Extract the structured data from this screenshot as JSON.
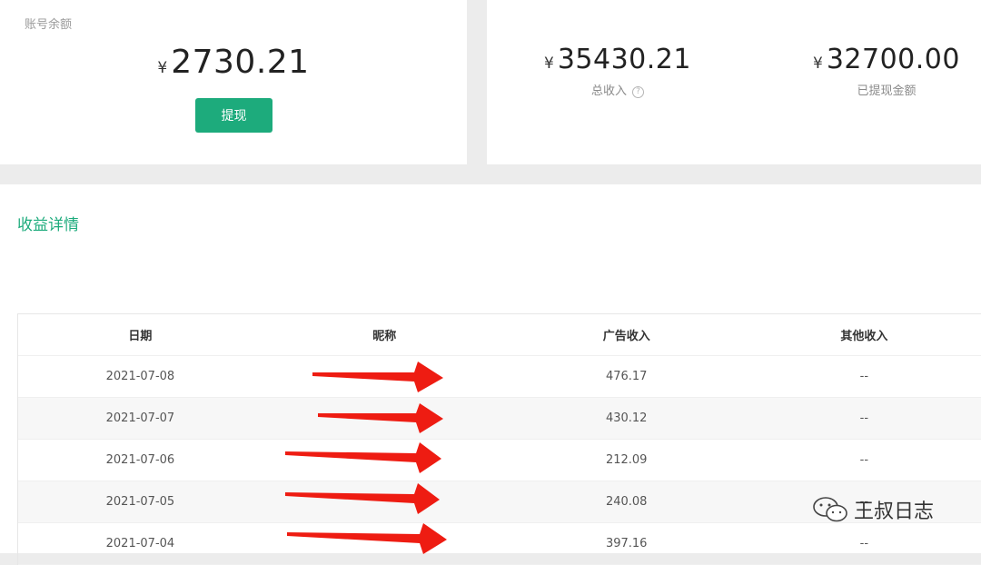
{
  "balance": {
    "label": "账号余额",
    "currency": "¥",
    "amount": "2730.21",
    "withdraw_label": "提现"
  },
  "totals": {
    "total_income": {
      "currency": "¥",
      "amount": "35430.21",
      "label": "总收入",
      "help": "?"
    },
    "withdrawn": {
      "currency": "¥",
      "amount": "32700.00",
      "label": "已提现金额"
    }
  },
  "details": {
    "title": "收益详情",
    "columns": [
      "日期",
      "昵称",
      "广告收入",
      "其他收入"
    ],
    "rows": [
      {
        "date": "2021-07-08",
        "nickname": "",
        "ad_income": "476.17",
        "other_income": "--"
      },
      {
        "date": "2021-07-07",
        "nickname": "",
        "ad_income": "430.12",
        "other_income": "--"
      },
      {
        "date": "2021-07-06",
        "nickname": "",
        "ad_income": "212.09",
        "other_income": "--"
      },
      {
        "date": "2021-07-05",
        "nickname": "",
        "ad_income": "240.08",
        "other_income": "--"
      },
      {
        "date": "2021-07-04",
        "nickname": "",
        "ad_income": "397.16",
        "other_income": "--"
      }
    ]
  },
  "watermark": {
    "text": "王叔日志",
    "icon": "wechat-icon"
  },
  "colors": {
    "accent": "#1dab7c",
    "arrow": "#ee1c12"
  }
}
